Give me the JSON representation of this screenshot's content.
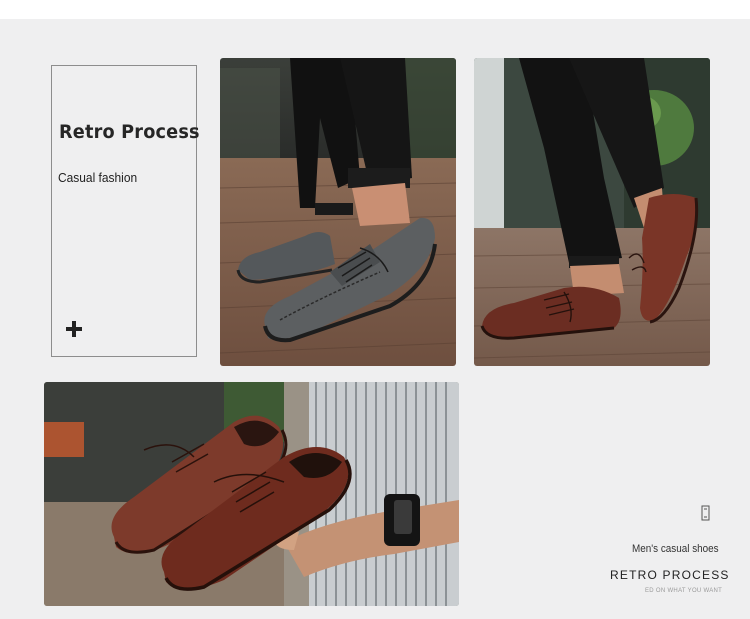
{
  "card": {
    "headline": "Retro Process",
    "subtitle": "Casual fashion",
    "icon": "plus-icon"
  },
  "photos": [
    {
      "subject": "grey leather lace-up loafers worn on wooden deck"
    },
    {
      "subject": "brown leather lace-up loafers worn on wooden deck"
    },
    {
      "subject": "hand holding a pair of brown leather loafers"
    }
  ],
  "caption": {
    "icon": "tag-outline-icon",
    "line1": "Men's casual shoes",
    "line2": "RETRO PROCESS",
    "line3": "ED ON WHAT YOU WANT"
  },
  "colors": {
    "panel_bg": "#efeff0",
    "text": "#222222",
    "grey_leather": "#5c5f61",
    "brown_leather": "#6b2d22"
  }
}
